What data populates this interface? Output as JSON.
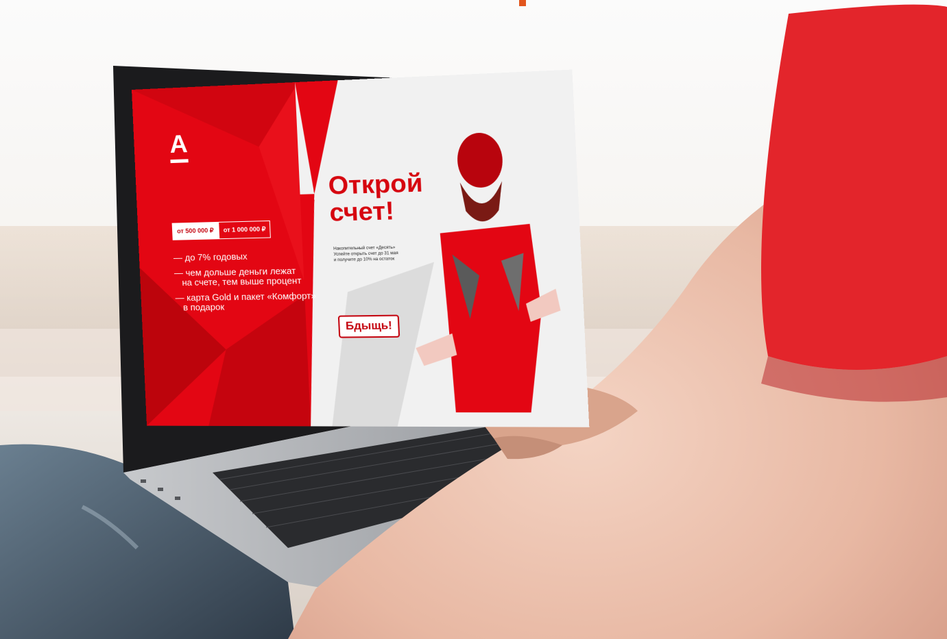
{
  "screen": {
    "tabs": [
      {
        "label": "от 500 000 ₽",
        "active": true
      },
      {
        "label": "от 1 000 000 ₽",
        "active": false
      }
    ],
    "bullets": [
      "— до 7% годовых",
      "— чем дольше деньги лежат\n   на счете, тем выше процент",
      "— карта Gold и пакет «Комфорт»\n   в подарок"
    ],
    "headline_line1": "Открой",
    "headline_line2": "счет!",
    "subtext": "Накопительный счет «Десять»\nУспейте открыть счет до 31 мая\nи получите до 10% на остаток",
    "cta_label": "Бдыщь!",
    "logo_glyph": "А"
  },
  "colors": {
    "brand_red": "#e30613",
    "button_red": "#c40510",
    "screen_light": "#f1f1f1"
  }
}
